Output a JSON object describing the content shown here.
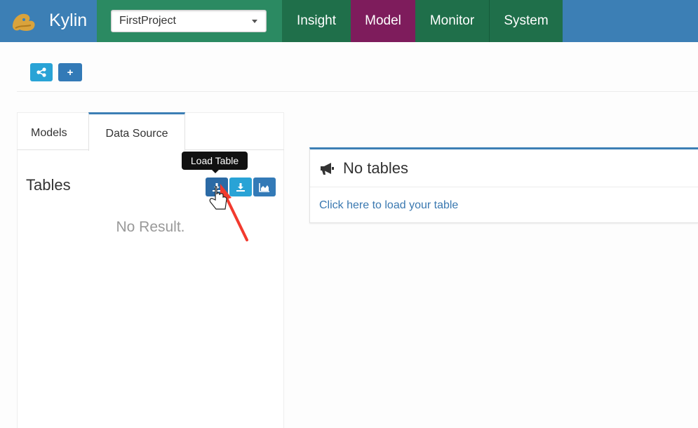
{
  "navbar": {
    "brand": "Kylin",
    "project_select": {
      "value": "FirstProject"
    },
    "items": [
      {
        "label": "Insight"
      },
      {
        "label": "Model"
      },
      {
        "label": "Monitor"
      },
      {
        "label": "System"
      }
    ],
    "active_item": "Model"
  },
  "toolbar": {
    "buttons": [
      {
        "icon": "share-nodes-icon"
      },
      {
        "icon": "plus-icon",
        "label": "+"
      }
    ]
  },
  "left_panel": {
    "tabs": [
      {
        "label": "Models"
      },
      {
        "label": "Data Source"
      }
    ],
    "active_tab": "Data Source",
    "tables_title": "Tables",
    "no_result": "No Result.",
    "tooltip": "Load Table",
    "buttons": [
      {
        "icon": "download-icon"
      },
      {
        "icon": "download-icon"
      },
      {
        "icon": "area-chart-icon"
      }
    ]
  },
  "right_panel": {
    "header": "No tables",
    "header_icon": "bullhorn-icon",
    "link": "Click here to load your table"
  },
  "colors": {
    "navbar_blue": "#3c7fb5",
    "nav_green": "#1f6f4a",
    "nav_active_purple": "#7e1c5c",
    "button_light_blue": "#29a3d6",
    "button_dark_blue": "#337ab7",
    "annotation_arrow": "#f23a2e"
  }
}
